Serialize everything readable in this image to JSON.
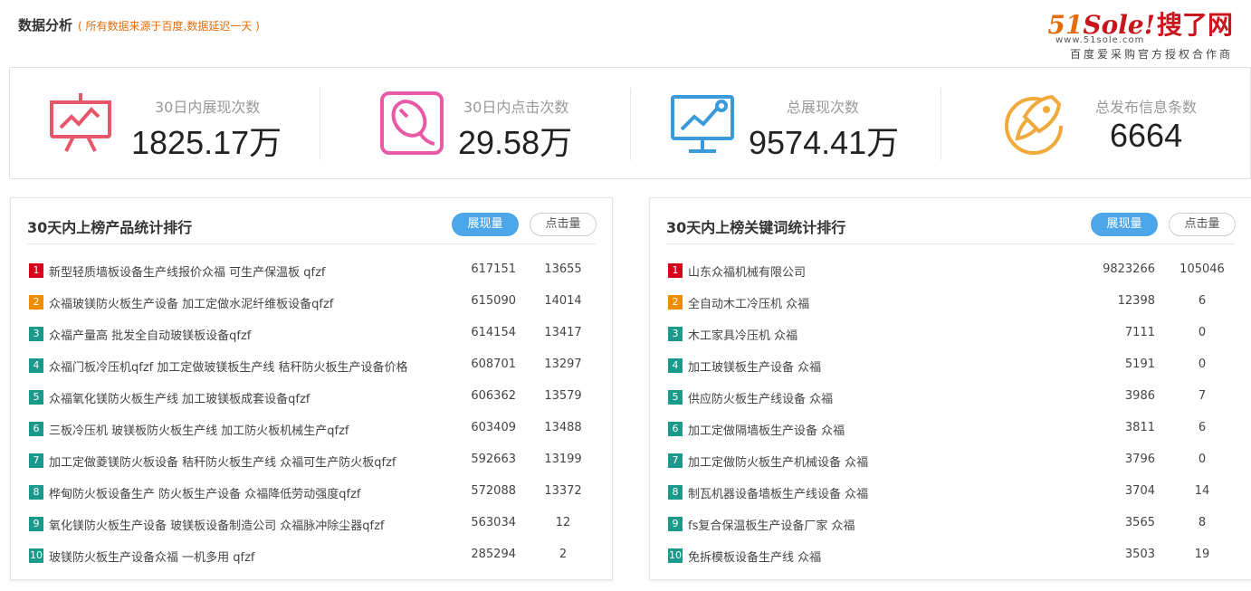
{
  "header": {
    "title": "数据分析",
    "subtitle": "( 所有数据来源于百度,数据延迟一天 )"
  },
  "logo": {
    "mark_51": "51",
    "mark_sole": "Sole!",
    "mark_cn": "搜了网",
    "domain": "www.51sole.com",
    "partner": "百度爱采购官方授权合作商"
  },
  "stats": [
    {
      "label": "30日内展现次数",
      "value": "1825.17万",
      "icon": "presentation-chart-icon",
      "color": "#e8566b"
    },
    {
      "label": "30日内点击次数",
      "value": "29.58万",
      "icon": "mouse-click-icon",
      "color": "#e95aa6"
    },
    {
      "label": "总展现次数",
      "value": "9574.41万",
      "icon": "monitor-chart-icon",
      "color": "#3b9ad9"
    },
    {
      "label": "总发布信息条数",
      "value": "6664",
      "icon": "rocket-icon",
      "color": "#f2a93b"
    }
  ],
  "colors": {
    "rank_1": "#d9001b",
    "rank_2": "#f08c00",
    "rank_other": "#1a9a8a",
    "tab_active": "#4ea6ea"
  },
  "products_panel": {
    "title": "30天内上榜产品统计排行",
    "tab_active": "展现量",
    "tab_inactive": "点击量",
    "rows": [
      {
        "rank": "1",
        "name": "新型轻质墙板设备生产线报价众福 可生产保温板 qfzf",
        "impressions": "617151",
        "clicks": "13655"
      },
      {
        "rank": "2",
        "name": "众福玻镁防火板生产设备 加工定做水泥纤维板设备qfzf",
        "impressions": "615090",
        "clicks": "14014"
      },
      {
        "rank": "3",
        "name": "众福产量高 批发全自动玻镁板设备qfzf",
        "impressions": "614154",
        "clicks": "13417"
      },
      {
        "rank": "4",
        "name": "众福门板冷压机qfzf 加工定做玻镁板生产线 秸秆防火板生产设备价格",
        "impressions": "608701",
        "clicks": "13297"
      },
      {
        "rank": "5",
        "name": "众福氧化镁防火板生产线 加工玻镁板成套设备qfzf",
        "impressions": "606362",
        "clicks": "13579"
      },
      {
        "rank": "6",
        "name": "三板冷压机 玻镁板防火板生产线 加工防火板机械生产qfzf",
        "impressions": "603409",
        "clicks": "13488"
      },
      {
        "rank": "7",
        "name": "加工定做菱镁防火板设备 秸秆防火板生产线 众福可生产防火板qfzf",
        "impressions": "592663",
        "clicks": "13199"
      },
      {
        "rank": "8",
        "name": "桦甸防火板设备生产 防火板生产设备 众福降低劳动强度qfzf",
        "impressions": "572088",
        "clicks": "13372"
      },
      {
        "rank": "9",
        "name": "氧化镁防火板生产设备 玻镁板设备制造公司 众福脉冲除尘器qfzf",
        "impressions": "563034",
        "clicks": "12"
      },
      {
        "rank": "10",
        "name": "玻镁防火板生产设备众福 一机多用 qfzf",
        "impressions": "285294",
        "clicks": "2"
      }
    ]
  },
  "keywords_panel": {
    "title": "30天内上榜关键词统计排行",
    "tab_active": "展现量",
    "tab_inactive": "点击量",
    "rows": [
      {
        "rank": "1",
        "name": "山东众福机械有限公司",
        "impressions": "9823266",
        "clicks": "105046"
      },
      {
        "rank": "2",
        "name": "全自动木工冷压机 众福",
        "impressions": "12398",
        "clicks": "6"
      },
      {
        "rank": "3",
        "name": "木工家具冷压机 众福",
        "impressions": "7111",
        "clicks": "0"
      },
      {
        "rank": "4",
        "name": "加工玻镁板生产设备 众福",
        "impressions": "5191",
        "clicks": "0"
      },
      {
        "rank": "5",
        "name": "供应防火板生产线设备 众福",
        "impressions": "3986",
        "clicks": "7"
      },
      {
        "rank": "6",
        "name": "加工定做隔墙板生产设备 众福",
        "impressions": "3811",
        "clicks": "6"
      },
      {
        "rank": "7",
        "name": "加工定做防火板生产机械设备 众福",
        "impressions": "3796",
        "clicks": "0"
      },
      {
        "rank": "8",
        "name": "制瓦机器设备墙板生产线设备 众福",
        "impressions": "3704",
        "clicks": "14"
      },
      {
        "rank": "9",
        "name": "fs复合保温板生产设备厂家 众福",
        "impressions": "3565",
        "clicks": "8"
      },
      {
        "rank": "10",
        "name": "免拆模板设备生产线 众福",
        "impressions": "3503",
        "clicks": "19"
      }
    ]
  }
}
